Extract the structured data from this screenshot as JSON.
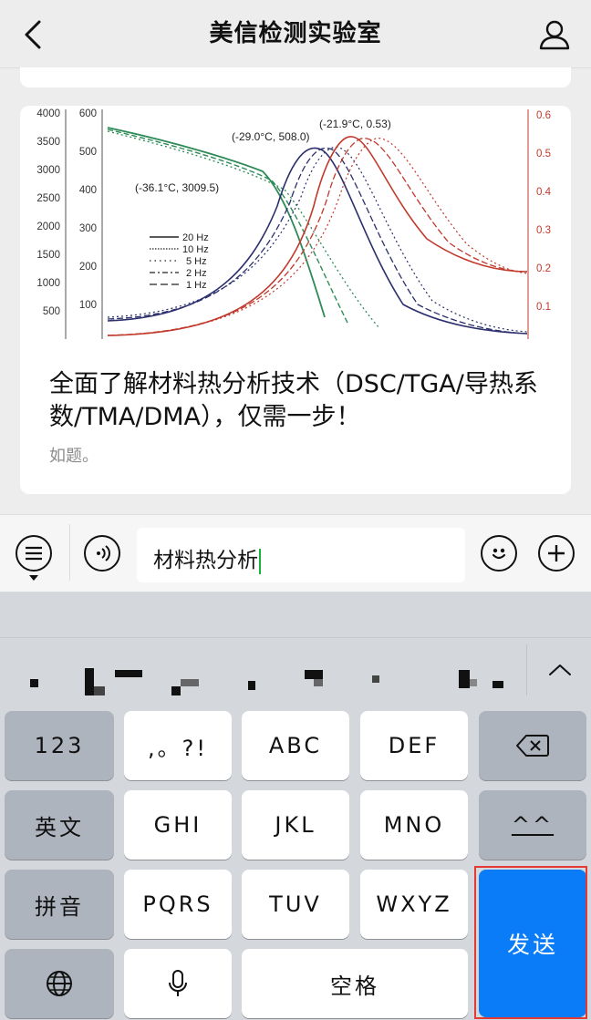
{
  "header": {
    "title": "美信检测实验室"
  },
  "article": {
    "title": "全面了解材料热分析技术（DSC/TGA/导热系数/TMA/DMA），仅需一步！",
    "description": "如题。",
    "figure": {
      "left_axis_ticks": [
        "4000",
        "3500",
        "3000",
        "2500",
        "2000",
        "1500",
        "1000",
        "500"
      ],
      "inner_left_axis_ticks": [
        "600",
        "500",
        "400",
        "300",
        "200",
        "100"
      ],
      "right_axis_ticks": [
        "0.6",
        "0.5",
        "0.4",
        "0.3",
        "0.2",
        "0.1"
      ],
      "annotations": [
        "(-21.9°C, 0.53)",
        "(-29.0°C, 508.0)",
        "(-36.1°C, 3009.5)"
      ],
      "legend": [
        "20 Hz",
        "10 Hz",
        "5 Hz",
        "2 Hz",
        "1 Hz"
      ],
      "colors": {
        "green": "#2e8b57",
        "navy": "#2b2f6b",
        "red": "#c0392b"
      }
    }
  },
  "input_bar": {
    "text": "材料热分析",
    "icons": [
      "menu-list-icon",
      "voice-icon",
      "emoji-icon",
      "plus-icon"
    ]
  },
  "keyboard": {
    "row1": [
      "123",
      ",。?!",
      "ABC",
      "DEF"
    ],
    "row2": [
      "英文",
      "GHI",
      "JKL",
      "MNO",
      "^^"
    ],
    "row3": [
      "拼音",
      "PQRS",
      "TUV",
      "WXYZ"
    ],
    "row4_space": "空格",
    "send": "发送",
    "icons": [
      "backspace-icon",
      "globe-icon",
      "microphone-icon",
      "chevron-up-icon"
    ]
  },
  "colors": {
    "send_button": "#0a7cf7",
    "caret": "#17b33d",
    "highlight_border": "#e53935"
  }
}
